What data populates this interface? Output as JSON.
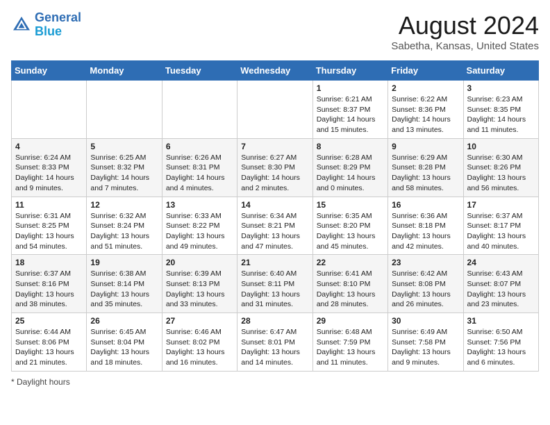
{
  "logo": {
    "line1": "General",
    "line2": "Blue"
  },
  "title": "August 2024",
  "subtitle": "Sabetha, Kansas, United States",
  "days_header": [
    "Sunday",
    "Monday",
    "Tuesday",
    "Wednesday",
    "Thursday",
    "Friday",
    "Saturday"
  ],
  "weeks": [
    [
      {
        "day": "",
        "info": ""
      },
      {
        "day": "",
        "info": ""
      },
      {
        "day": "",
        "info": ""
      },
      {
        "day": "",
        "info": ""
      },
      {
        "day": "1",
        "info": "Sunrise: 6:21 AM\nSunset: 8:37 PM\nDaylight: 14 hours\nand 15 minutes."
      },
      {
        "day": "2",
        "info": "Sunrise: 6:22 AM\nSunset: 8:36 PM\nDaylight: 14 hours\nand 13 minutes."
      },
      {
        "day": "3",
        "info": "Sunrise: 6:23 AM\nSunset: 8:35 PM\nDaylight: 14 hours\nand 11 minutes."
      }
    ],
    [
      {
        "day": "4",
        "info": "Sunrise: 6:24 AM\nSunset: 8:33 PM\nDaylight: 14 hours\nand 9 minutes."
      },
      {
        "day": "5",
        "info": "Sunrise: 6:25 AM\nSunset: 8:32 PM\nDaylight: 14 hours\nand 7 minutes."
      },
      {
        "day": "6",
        "info": "Sunrise: 6:26 AM\nSunset: 8:31 PM\nDaylight: 14 hours\nand 4 minutes."
      },
      {
        "day": "7",
        "info": "Sunrise: 6:27 AM\nSunset: 8:30 PM\nDaylight: 14 hours\nand 2 minutes."
      },
      {
        "day": "8",
        "info": "Sunrise: 6:28 AM\nSunset: 8:29 PM\nDaylight: 14 hours\nand 0 minutes."
      },
      {
        "day": "9",
        "info": "Sunrise: 6:29 AM\nSunset: 8:28 PM\nDaylight: 13 hours\nand 58 minutes."
      },
      {
        "day": "10",
        "info": "Sunrise: 6:30 AM\nSunset: 8:26 PM\nDaylight: 13 hours\nand 56 minutes."
      }
    ],
    [
      {
        "day": "11",
        "info": "Sunrise: 6:31 AM\nSunset: 8:25 PM\nDaylight: 13 hours\nand 54 minutes."
      },
      {
        "day": "12",
        "info": "Sunrise: 6:32 AM\nSunset: 8:24 PM\nDaylight: 13 hours\nand 51 minutes."
      },
      {
        "day": "13",
        "info": "Sunrise: 6:33 AM\nSunset: 8:22 PM\nDaylight: 13 hours\nand 49 minutes."
      },
      {
        "day": "14",
        "info": "Sunrise: 6:34 AM\nSunset: 8:21 PM\nDaylight: 13 hours\nand 47 minutes."
      },
      {
        "day": "15",
        "info": "Sunrise: 6:35 AM\nSunset: 8:20 PM\nDaylight: 13 hours\nand 45 minutes."
      },
      {
        "day": "16",
        "info": "Sunrise: 6:36 AM\nSunset: 8:18 PM\nDaylight: 13 hours\nand 42 minutes."
      },
      {
        "day": "17",
        "info": "Sunrise: 6:37 AM\nSunset: 8:17 PM\nDaylight: 13 hours\nand 40 minutes."
      }
    ],
    [
      {
        "day": "18",
        "info": "Sunrise: 6:37 AM\nSunset: 8:16 PM\nDaylight: 13 hours\nand 38 minutes."
      },
      {
        "day": "19",
        "info": "Sunrise: 6:38 AM\nSunset: 8:14 PM\nDaylight: 13 hours\nand 35 minutes."
      },
      {
        "day": "20",
        "info": "Sunrise: 6:39 AM\nSunset: 8:13 PM\nDaylight: 13 hours\nand 33 minutes."
      },
      {
        "day": "21",
        "info": "Sunrise: 6:40 AM\nSunset: 8:11 PM\nDaylight: 13 hours\nand 31 minutes."
      },
      {
        "day": "22",
        "info": "Sunrise: 6:41 AM\nSunset: 8:10 PM\nDaylight: 13 hours\nand 28 minutes."
      },
      {
        "day": "23",
        "info": "Sunrise: 6:42 AM\nSunset: 8:08 PM\nDaylight: 13 hours\nand 26 minutes."
      },
      {
        "day": "24",
        "info": "Sunrise: 6:43 AM\nSunset: 8:07 PM\nDaylight: 13 hours\nand 23 minutes."
      }
    ],
    [
      {
        "day": "25",
        "info": "Sunrise: 6:44 AM\nSunset: 8:06 PM\nDaylight: 13 hours\nand 21 minutes."
      },
      {
        "day": "26",
        "info": "Sunrise: 6:45 AM\nSunset: 8:04 PM\nDaylight: 13 hours\nand 18 minutes."
      },
      {
        "day": "27",
        "info": "Sunrise: 6:46 AM\nSunset: 8:02 PM\nDaylight: 13 hours\nand 16 minutes."
      },
      {
        "day": "28",
        "info": "Sunrise: 6:47 AM\nSunset: 8:01 PM\nDaylight: 13 hours\nand 14 minutes."
      },
      {
        "day": "29",
        "info": "Sunrise: 6:48 AM\nSunset: 7:59 PM\nDaylight: 13 hours\nand 11 minutes."
      },
      {
        "day": "30",
        "info": "Sunrise: 6:49 AM\nSunset: 7:58 PM\nDaylight: 13 hours\nand 9 minutes."
      },
      {
        "day": "31",
        "info": "Sunrise: 6:50 AM\nSunset: 7:56 PM\nDaylight: 13 hours\nand 6 minutes."
      }
    ]
  ],
  "footer": "Daylight hours"
}
